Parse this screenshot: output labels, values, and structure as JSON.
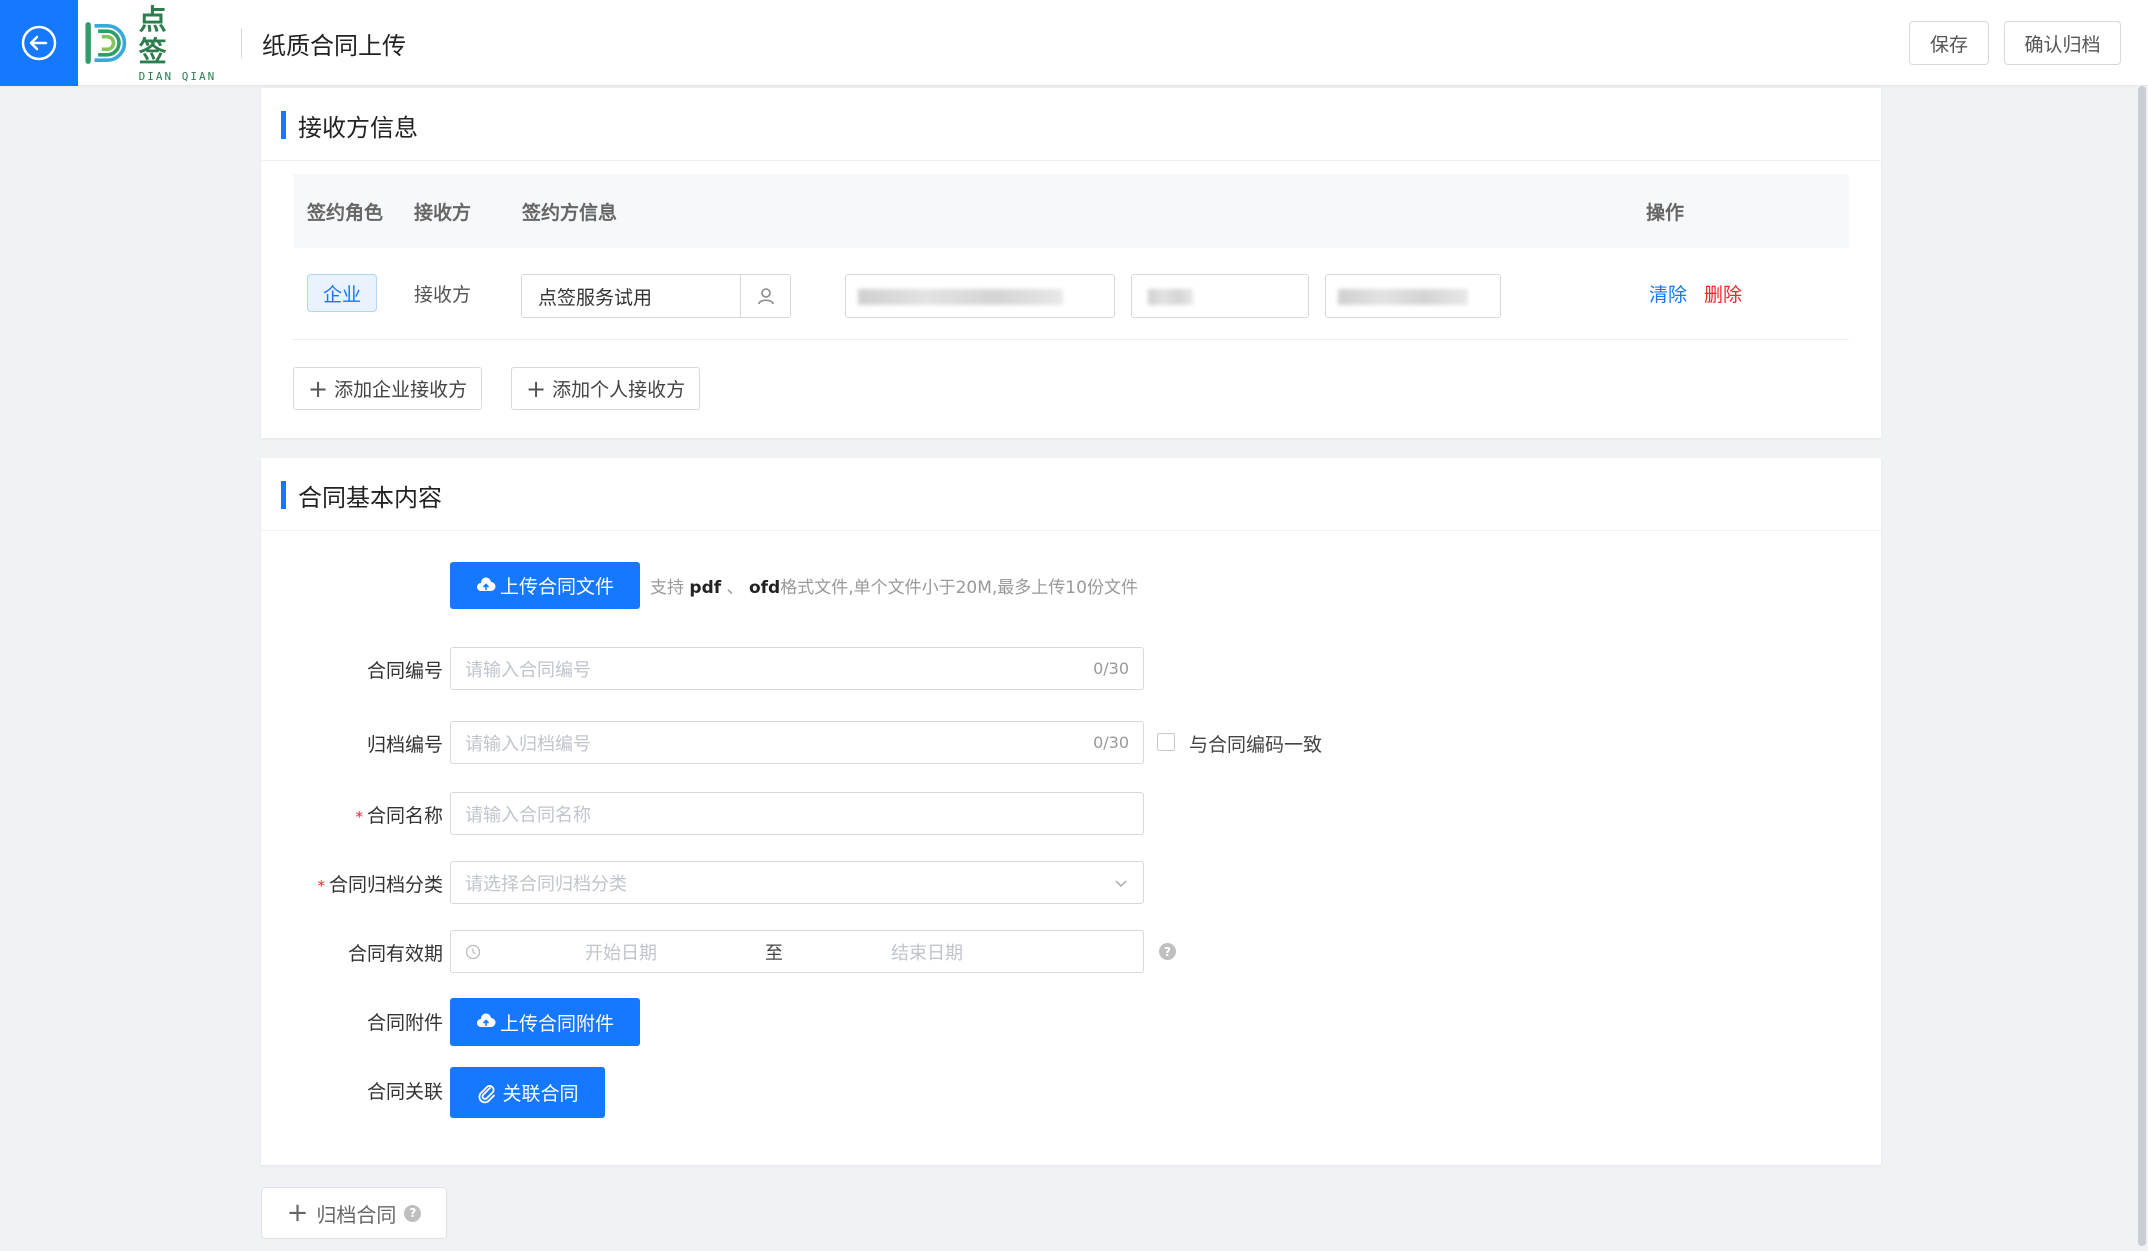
{
  "header": {
    "logo_cn": "点 签",
    "logo_en": "DIAN QIAN",
    "title": "纸质合同上传",
    "save_label": "保存",
    "confirm_label": "确认归档"
  },
  "receivers": {
    "title": "接收方信息",
    "columns": {
      "role": "签约角色",
      "party": "接收方",
      "info": "签约方信息",
      "action": "操作"
    },
    "rows": [
      {
        "tag": "企业",
        "role": "接收方",
        "company": "点签服务试用",
        "clear_label": "清除",
        "delete_label": "删除"
      }
    ],
    "add_company_label": "添加企业接收方",
    "add_person_label": "添加个人接收方"
  },
  "contract": {
    "title": "合同基本内容",
    "upload_file_label": "上传合同文件",
    "upload_hint_prefix": "支持",
    "upload_hint_pdf": "pdf",
    "upload_hint_sep": "、",
    "upload_hint_ofd": "ofd",
    "upload_hint_suffix": "格式文件,单个文件小于20M,最多上传10份文件",
    "number": {
      "label": "合同编号",
      "placeholder": "请输入合同编号",
      "count": "0/30"
    },
    "archive_number": {
      "label": "归档编号",
      "placeholder": "请输入归档编号",
      "count": "0/30",
      "same_as_label": "与合同编码一致"
    },
    "name": {
      "label": "合同名称",
      "placeholder": "请输入合同名称"
    },
    "category": {
      "label": "合同归档分类",
      "placeholder": "请选择合同归档分类"
    },
    "validity": {
      "label": "合同有效期",
      "start_placeholder": "开始日期",
      "to": "至",
      "end_placeholder": "结束日期"
    },
    "attachment": {
      "label": "合同附件",
      "button": "上传合同附件"
    },
    "relation": {
      "label": "合同关联",
      "button": "关联合同"
    }
  },
  "footer": {
    "archive_label": "归档合同"
  },
  "colors": {
    "primary": "#1677ff",
    "danger": "#f5222d",
    "logo_green": "#2e7d4f"
  }
}
